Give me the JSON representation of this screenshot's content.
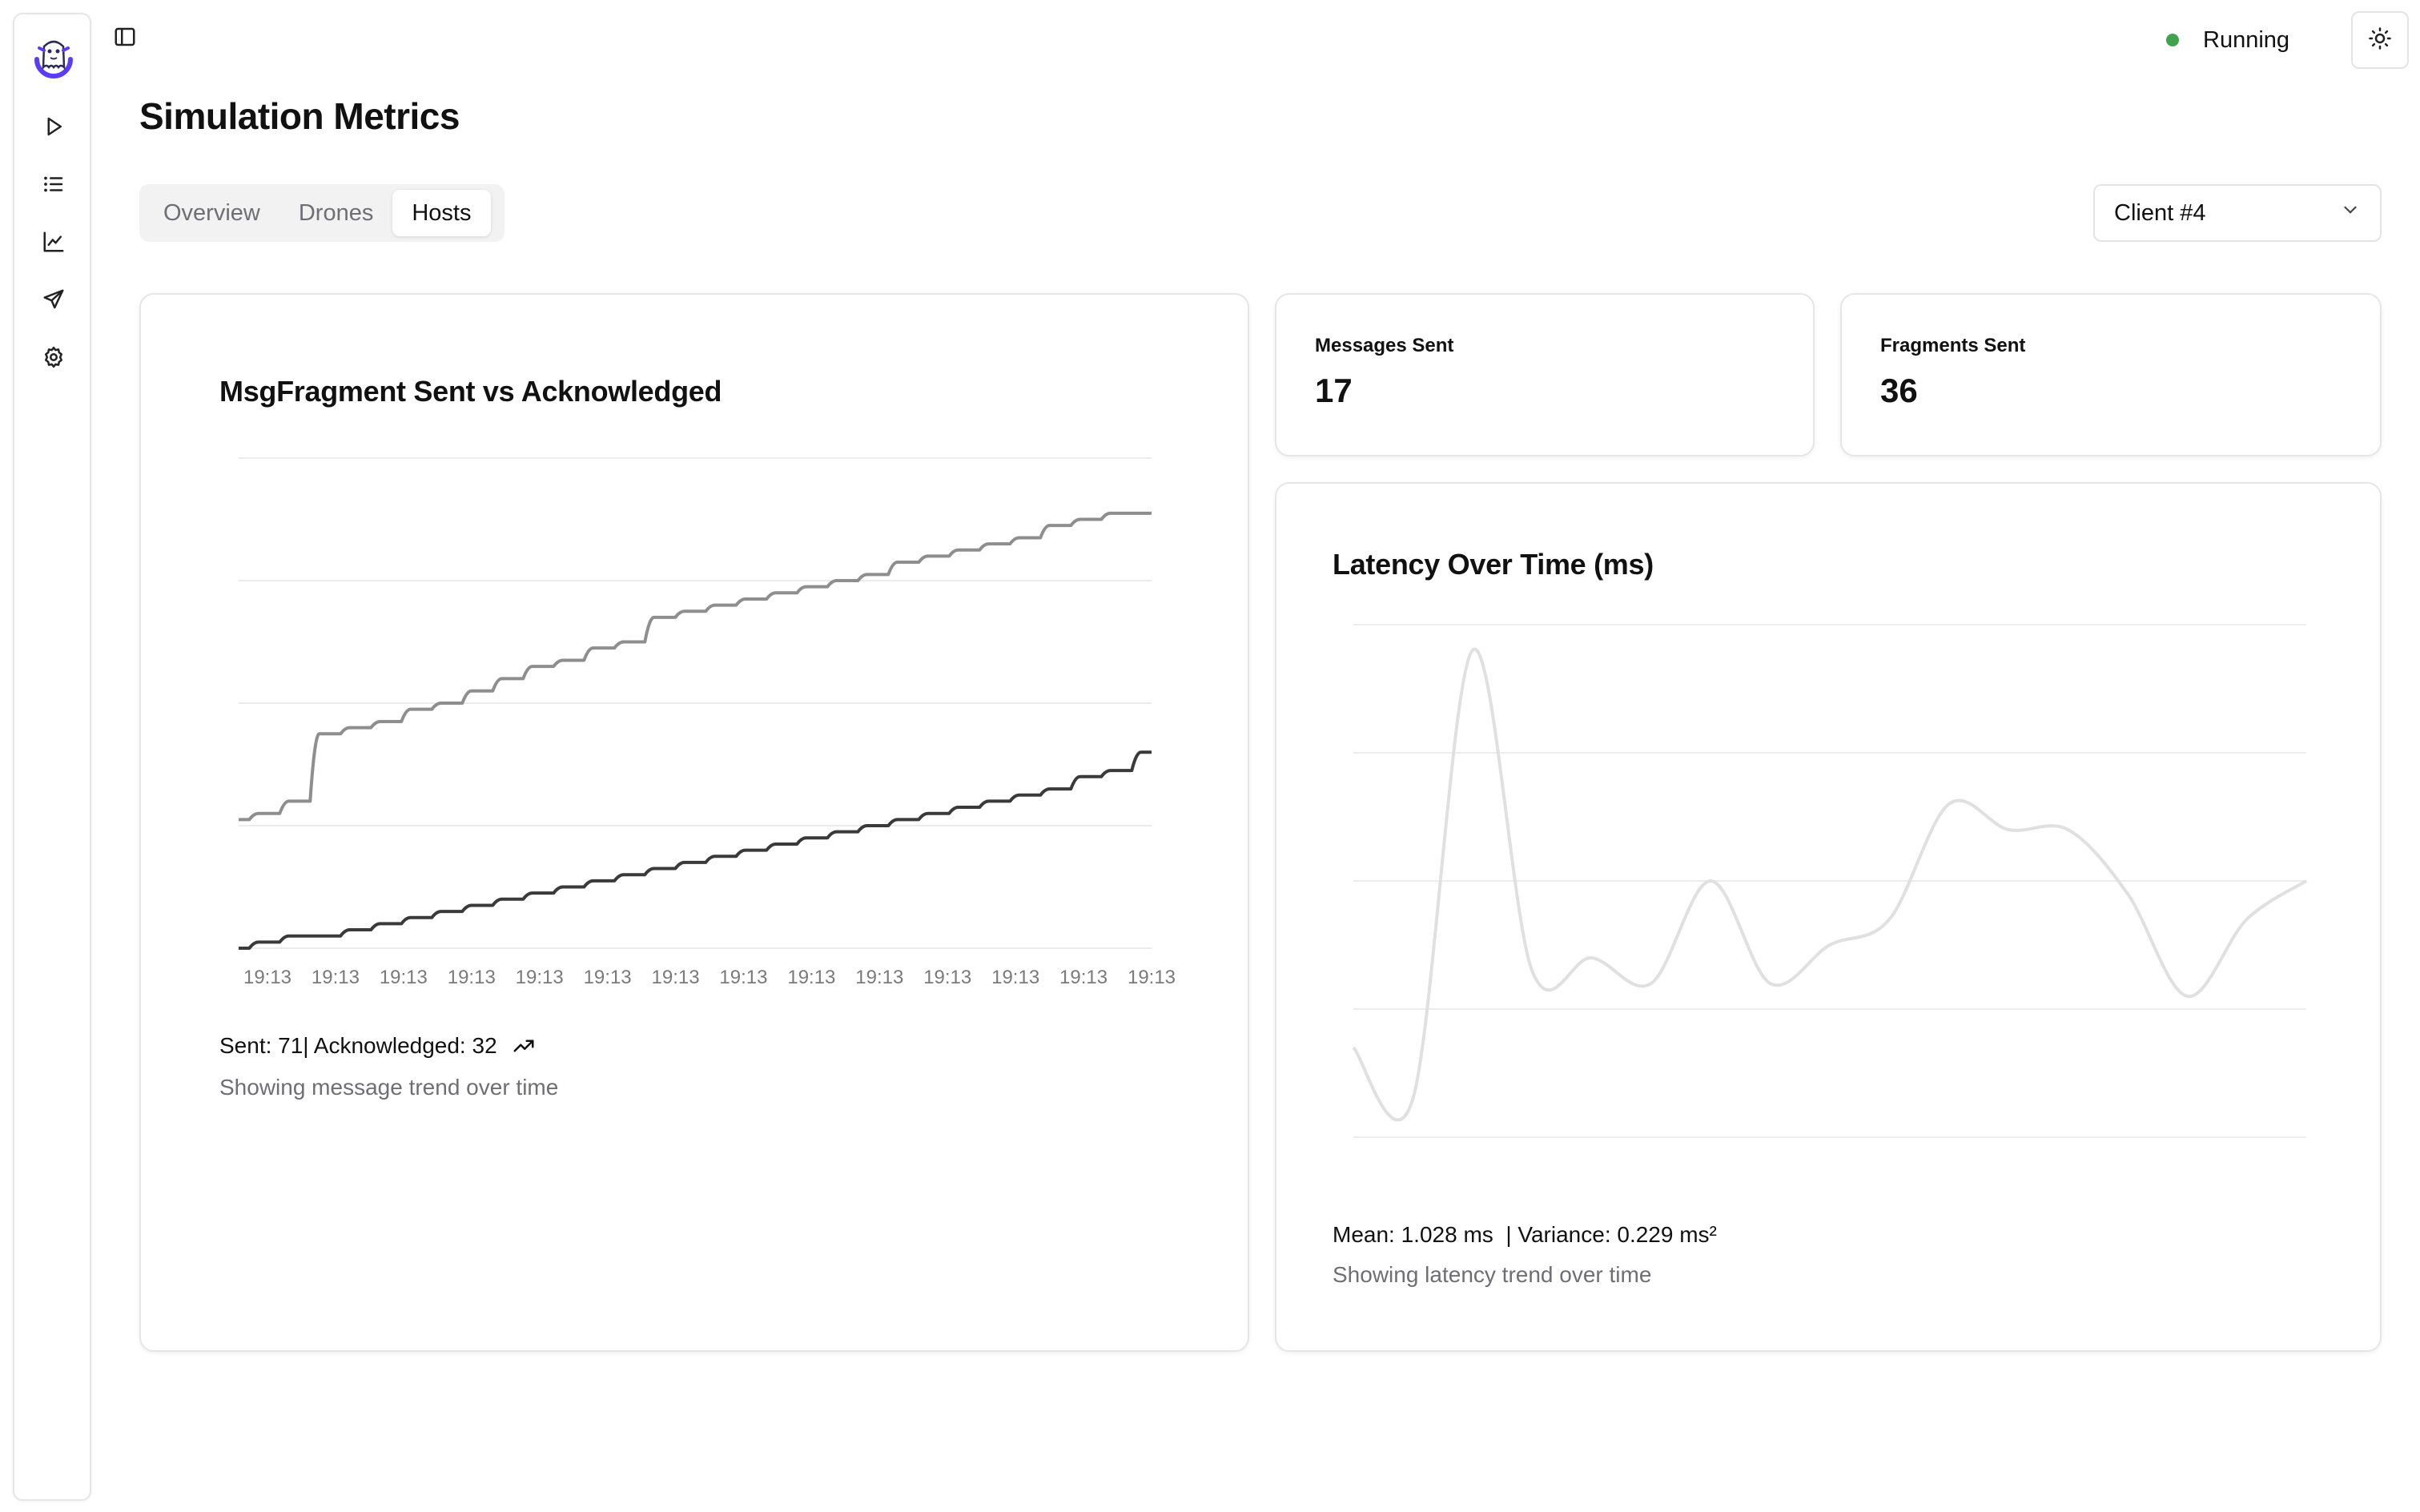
{
  "app": {
    "status": "Running",
    "status_color": "#3fa34d"
  },
  "sidebar": {
    "logo": "ghost-logo-icon",
    "items": [
      {
        "icon": "play-icon"
      },
      {
        "icon": "list-icon"
      },
      {
        "icon": "chart-icon"
      },
      {
        "icon": "send-icon"
      },
      {
        "icon": "settings-icon"
      }
    ]
  },
  "page": {
    "title": "Simulation Metrics"
  },
  "tabs": [
    {
      "label": "Overview",
      "active": false
    },
    {
      "label": "Drones",
      "active": false
    },
    {
      "label": "Hosts",
      "active": true
    }
  ],
  "client_select": {
    "value": "Client #4"
  },
  "stats": [
    {
      "label": "Messages Sent",
      "value": "17"
    },
    {
      "label": "Fragments Sent",
      "value": "36"
    }
  ],
  "msg_chart": {
    "title": "MsgFragment Sent vs Acknowledged",
    "summary": "Sent: 71| Acknowledged: 32",
    "trend_icon": "trending-up-icon",
    "description": "Showing message trend over time"
  },
  "latency_chart": {
    "title": "Latency Over Time (ms)",
    "summary": "Mean: 1.028 ms  | Variance: 0.229 ms²",
    "description": "Showing latency trend over time"
  },
  "chart_data": [
    {
      "type": "line",
      "title": "MsgFragment Sent vs Acknowledged",
      "x": [
        "19:13",
        "19:13",
        "19:13",
        "19:13",
        "19:13",
        "19:13",
        "19:13",
        "19:13",
        "19:13",
        "19:13",
        "19:13",
        "19:13",
        "19:13",
        "19:13"
      ],
      "ylim": [
        0,
        80
      ],
      "grid": true,
      "series": [
        {
          "color": "#8e8e8e",
          "values": [
            21,
            22,
            24,
            35,
            36,
            37,
            39,
            40,
            42,
            44,
            46,
            47,
            49,
            50,
            54,
            55,
            56,
            57,
            58,
            59,
            60,
            61,
            63,
            64,
            65,
            66,
            67,
            69,
            70,
            71,
            71
          ]
        },
        {
          "color": "#3a3a3a",
          "values": [
            0,
            1,
            2,
            2,
            3,
            4,
            5,
            6,
            7,
            8,
            9,
            10,
            11,
            12,
            13,
            14,
            15,
            16,
            17,
            18,
            19,
            20,
            21,
            22,
            23,
            24,
            25,
            26,
            28,
            29,
            32
          ]
        }
      ]
    },
    {
      "type": "line",
      "title": "Latency Over Time (ms)",
      "ylim": [
        0,
        4
      ],
      "grid": true,
      "series": [
        {
          "color": "#e0e0e0",
          "values": [
            0.7,
            0.3,
            3.8,
            1.3,
            1.4,
            1.2,
            2.0,
            1.2,
            1.5,
            1.7,
            2.6,
            2.4,
            2.4,
            1.9,
            1.1,
            1.7,
            2.0
          ]
        }
      ]
    }
  ]
}
